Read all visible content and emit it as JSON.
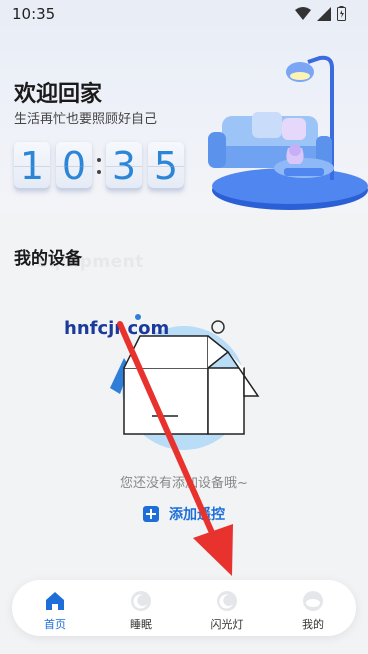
{
  "status_bar": {
    "time": "10:35"
  },
  "header": {
    "title": "欢迎回家",
    "subtitle": "生活再忙也要照顾好自己",
    "clock_digits": [
      "1",
      "0",
      "3",
      "5"
    ]
  },
  "devices": {
    "title": "我的设备",
    "ghost_title": "Equipment",
    "empty_text": "您还没有添加设备哦~",
    "add_label": "添加遥控"
  },
  "watermark": "hnfcjr.com",
  "nav": {
    "items": [
      {
        "label": "首页",
        "icon": "home-icon",
        "active": true
      },
      {
        "label": "睡眠",
        "icon": "moon-icon",
        "active": false
      },
      {
        "label": "闪光灯",
        "icon": "flash-icon",
        "active": false
      },
      {
        "label": "我的",
        "icon": "profile-icon",
        "active": false
      }
    ]
  },
  "colors": {
    "accent": "#1d6ed8",
    "clock_digit": "#2c86d8",
    "annotation_arrow": "#e8322d",
    "watermark": "#1b3a9b"
  }
}
